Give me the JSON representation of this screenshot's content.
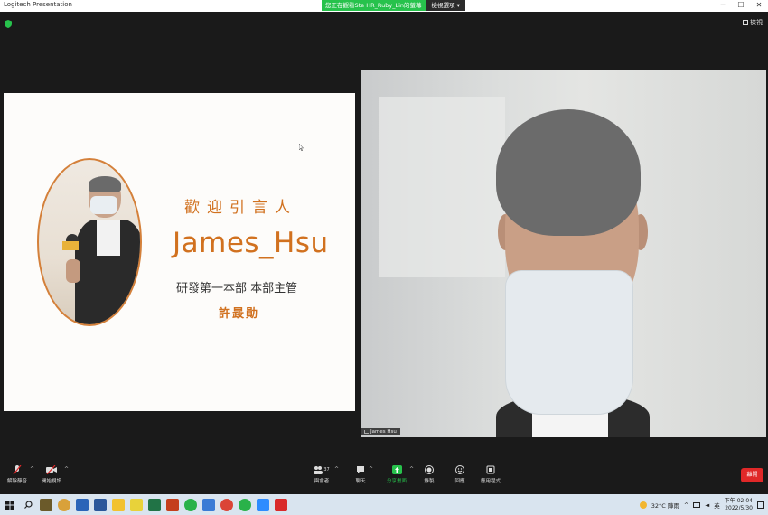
{
  "titlebar": {
    "app_title": "Logitech Presentation",
    "share_banner": "您正在觀看Ste  HR_Ruby_Lin的螢幕",
    "view_options": "檢視選項 ▾",
    "minimize": "─",
    "maximize": "☐",
    "close": "✕"
  },
  "top": {
    "view_label": "檢視"
  },
  "slide": {
    "welcome": "歡迎引言人",
    "speaker_name": "James_Hsu",
    "role": "研發第一本部 本部主管",
    "chinese_name": "許晸勛"
  },
  "video": {
    "participant_name": "James Hsu"
  },
  "controls": {
    "unmute": "解除靜音",
    "start_video": "開始視訊",
    "participants_count": "37",
    "participants": "與會者",
    "chat": "聊天",
    "share_screen": "分享畫面",
    "record": "錄製",
    "reactions": "回應",
    "apps": "應用程式",
    "leave": "離開"
  },
  "tray": {
    "temperature": "32°C 陣雨",
    "ime": "英",
    "time": "下午 02:04",
    "date": "2022/5/30"
  },
  "colors": {
    "accent_orange": "#d1711f",
    "zoom_green": "#27c24c",
    "leave_red": "#e02828"
  }
}
